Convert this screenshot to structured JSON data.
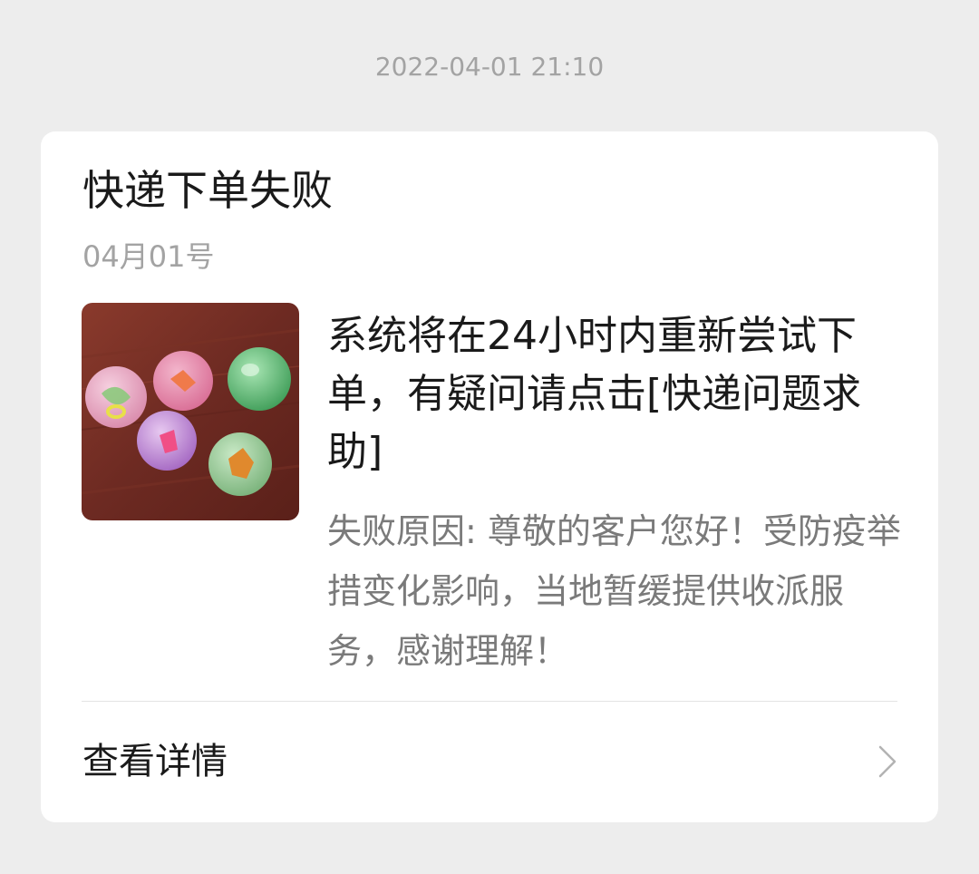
{
  "timestamp": "2022-04-01 21:10",
  "card": {
    "title": "快递下单失败",
    "date": "04月01号",
    "main_text": "系统将在24小时内重新尝试下单，有疑问请点击[快递问题求助]",
    "reason_text": "失败原因: 尊敬的客户您好！受防疫举措变化影响，当地暂缓提供收派服务，感谢理解！",
    "thumbnail": "photo of five colorful toy capsule balls on a wooden table",
    "details_label": "查看详情",
    "details_icon": "chevron-right-icon"
  },
  "colors": {
    "background": "#ededed",
    "card": "#ffffff",
    "primary_text": "#1a1a1a",
    "secondary_text": "#7a7a7a",
    "muted_text": "#a3a3a3"
  }
}
